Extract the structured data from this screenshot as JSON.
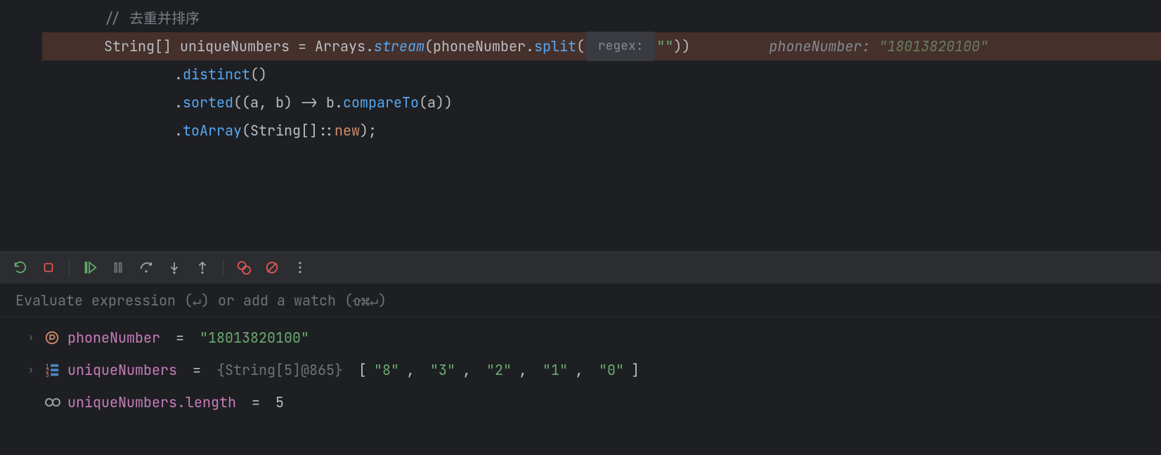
{
  "editor": {
    "comment1": "// 去重并排序",
    "line2": {
      "type": "String",
      "brackets": "[] ",
      "ident": "uniqueNumbers",
      "assign": " = ",
      "cls": "Arrays",
      "dot1": ".",
      "stream": "stream",
      "open1": "(",
      "obj": "phoneNumber",
      "dot2": ".",
      "split": "split",
      "open2": "(",
      "hint_regex": " regex: ",
      "emptystr": "\"\"",
      "close": "))",
      "inline1": "phoneNumber: ",
      "inline2": "\"18013820100\""
    },
    "line3": {
      "dot": ".",
      "method": "distinct",
      "call": "()"
    },
    "line4": {
      "dot": ".",
      "method": "sorted",
      "open": "((",
      "a": "a",
      "c1": ", ",
      "b": "b",
      "arrow": ") -> ",
      "bvar": "b",
      "dot2": ".",
      "cmp": "compareTo",
      "open2": "(",
      "avar": "a",
      "close": "))"
    },
    "line5": {
      "dot": ".",
      "method": "toArray",
      "open": "(",
      "type": "String",
      "br": "[]",
      "cc": "::",
      "kw": "new",
      "close": ");"
    },
    "comment2_partial": "  "
  },
  "watch": {
    "placeholder": "Evaluate expression (↵) or add a watch (⇧⌘↵)"
  },
  "vars": {
    "phoneNumber": {
      "name": "phoneNumber",
      "eq": " = ",
      "value": "\"18013820100\""
    },
    "uniqueNumbers": {
      "name": "uniqueNumbers",
      "eq": " = ",
      "type": "{String[5]@865} ",
      "arr_open": "[",
      "v0": "\"8\"",
      "c0": ", ",
      "v1": "\"3\"",
      "c1": ", ",
      "v2": "\"2\"",
      "c2": ", ",
      "v3": "\"1\"",
      "c3": ", ",
      "v4": "\"0\"",
      "arr_close": "]"
    },
    "length": {
      "name": "uniqueNumbers.length",
      "eq": " = ",
      "value": "5"
    }
  }
}
